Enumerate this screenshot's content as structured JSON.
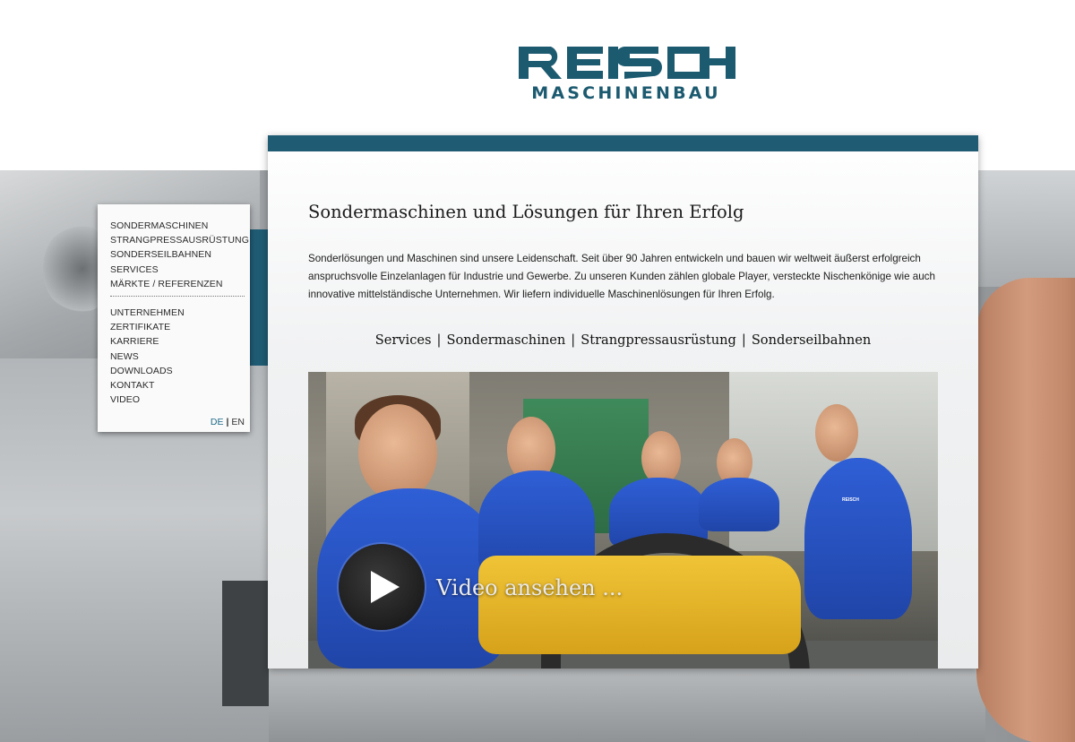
{
  "brand": {
    "name": "REISCH",
    "tagline": "MASCHINENBAU",
    "color": "#1c5a70"
  },
  "sidebar": {
    "primary_items": [
      {
        "label": "SONDERMASCHINEN"
      },
      {
        "label": "STRANGPRESSAUSRÜSTUNG"
      },
      {
        "label": "SONDERSEILBAHNEN"
      },
      {
        "label": "SERVICES"
      },
      {
        "label": "MÄRKTE / REFERENZEN"
      }
    ],
    "secondary_items": [
      {
        "label": "UNTERNEHMEN"
      },
      {
        "label": "ZERTIFIKATE"
      },
      {
        "label": "KARRIERE"
      },
      {
        "label": "NEWS"
      },
      {
        "label": "DOWNLOADS"
      },
      {
        "label": "KONTAKT"
      },
      {
        "label": "VIDEO"
      }
    ],
    "language": {
      "de": "DE",
      "separator": "|",
      "en": "EN",
      "active": "DE"
    }
  },
  "main": {
    "title": "Sondermaschinen und Lösungen für Ihren Erfolg",
    "intro": "Sonderlösungen und Maschinen sind unsere Leidenschaft. Seit über 90 Jahren entwickeln und bauen wir weltweit äußerst erfolgreich anspruchsvolle Einzelanlagen für Industrie und Gewerbe. Zu unseren Kunden zählen globale Player, versteckte Nischenkönige wie auch innovative mittelständische Unternehmen. Wir liefern individuelle Maschinenlösungen für Ihren Erfolg.",
    "quick_links": [
      {
        "label": "Services"
      },
      {
        "label": "Sondermaschinen"
      },
      {
        "label": "Strangpressausrüstung"
      },
      {
        "label": "Sonderseilbahnen"
      }
    ],
    "link_separator": "|",
    "video": {
      "caption": "Video ansehen ...",
      "play_icon": "play-icon",
      "shirt_logo": "REISCH"
    }
  },
  "colors": {
    "accent": "#1f5b73",
    "language_active": "#1f6a87"
  }
}
